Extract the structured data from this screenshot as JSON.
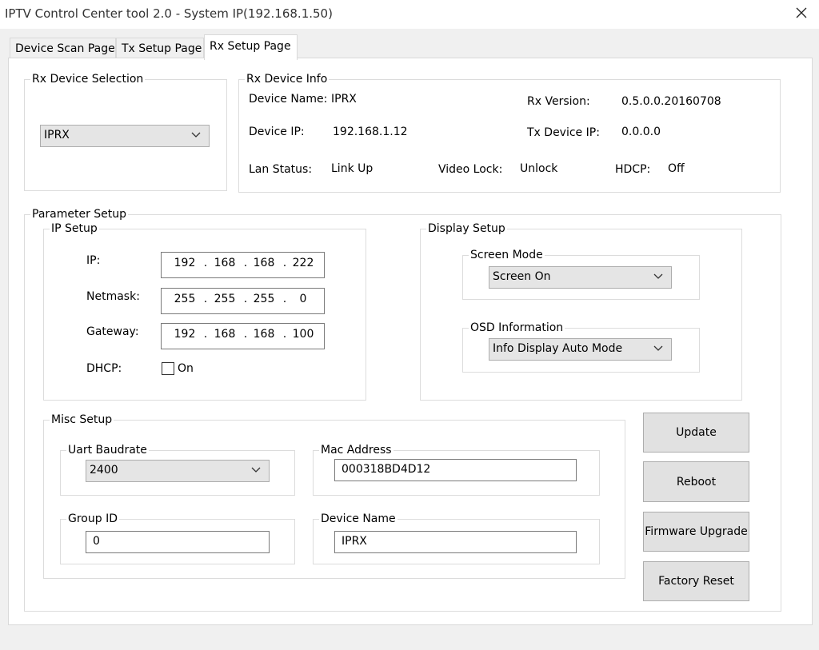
{
  "window": {
    "title": "IPTV Control Center tool 2.0 - System IP(192.168.1.50)",
    "close_icon": "close-icon"
  },
  "tabs": [
    {
      "label": "Device Scan Page",
      "active": false
    },
    {
      "label": "Tx Setup Page",
      "active": false
    },
    {
      "label": "Rx Setup Page",
      "active": true
    }
  ],
  "rx_device_selection": {
    "title": "Rx Device Selection",
    "selected": "IPRX"
  },
  "rx_device_info": {
    "title": "Rx Device Info",
    "device_name_label": "Device Name:",
    "device_name": "IPRX",
    "rx_version_label": "Rx Version:",
    "rx_version": "0.5.0.0.20160708",
    "device_ip_label": "Device IP:",
    "device_ip": "192.168.1.12",
    "tx_device_ip_label": "Tx Device IP:",
    "tx_device_ip": "0.0.0.0",
    "lan_status_label": "Lan Status:",
    "lan_status": "Link Up",
    "video_lock_label": "Video Lock:",
    "video_lock": "Unlock",
    "hdcp_label": "HDCP:",
    "hdcp": "Off"
  },
  "parameter_setup": {
    "title": "Parameter Setup",
    "ip_setup": {
      "title": "IP Setup",
      "ip_label": "IP:",
      "ip": [
        "192",
        "168",
        "168",
        "222"
      ],
      "netmask_label": "Netmask:",
      "netmask": [
        "255",
        "255",
        "255",
        "0"
      ],
      "gateway_label": "Gateway:",
      "gateway": [
        "192",
        "168",
        "168",
        "100"
      ],
      "dhcp_label": "DHCP:",
      "dhcp_checkbox_label": "On",
      "dhcp_checked": false,
      "dot": "."
    },
    "display_setup": {
      "title": "Display Setup",
      "screen_mode_title": "Screen Mode",
      "screen_mode": "Screen On",
      "osd_title": "OSD Information",
      "osd": "Info Display Auto Mode"
    },
    "misc_setup": {
      "title": "Misc Setup",
      "uart_title": "Uart Baudrate",
      "uart": "2400",
      "mac_title": "Mac Address",
      "mac": "000318BD4D12",
      "group_id_title": "Group ID",
      "group_id": "0",
      "device_name_title": "Device Name",
      "device_name": "IPRX"
    }
  },
  "buttons": {
    "update": "Update",
    "reboot": "Reboot",
    "firmware_upgrade": "Firmware Upgrade",
    "factory_reset": "Factory Reset"
  }
}
